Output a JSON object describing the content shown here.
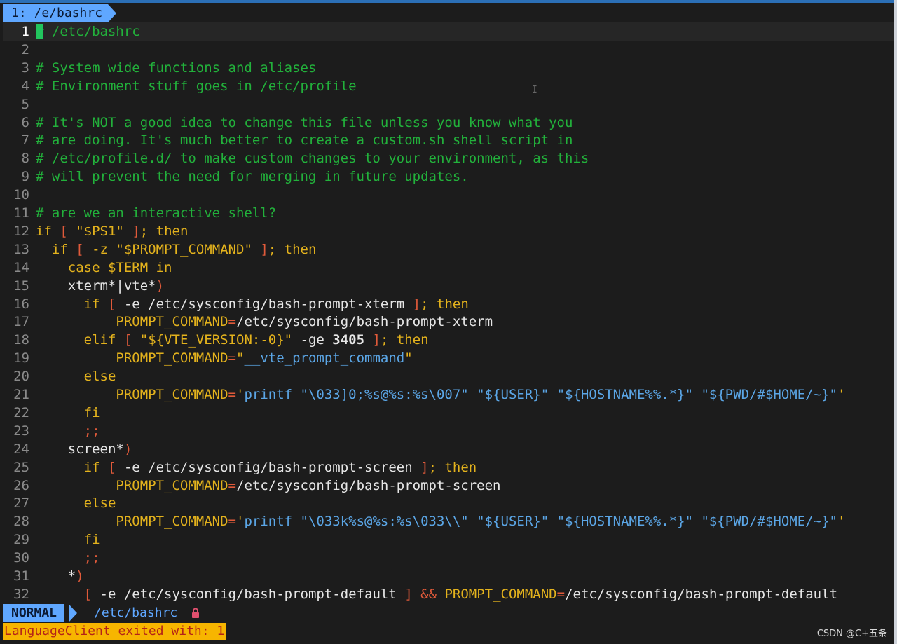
{
  "tab": {
    "label": "1: /e/bashrc"
  },
  "status": {
    "mode": "NORMAL",
    "file": "/etc/bashrc"
  },
  "message": "LanguageClient exited with: 1",
  "watermark": "CSDN @C+五条",
  "colors": {
    "comment": "#22b13b",
    "keyword": "#e3b21d",
    "bracket": "#e05a3a",
    "string": "#5ba6e6",
    "accent": "#5fa7ff"
  },
  "lines": [
    {
      "n": "1",
      "current": true,
      "segs": [
        [
          "cursor",
          "#"
        ],
        [
          "c",
          " /etc/bashrc"
        ]
      ]
    },
    {
      "n": "2",
      "segs": []
    },
    {
      "n": "3",
      "segs": [
        [
          "c",
          "# System wide functions and aliases"
        ]
      ]
    },
    {
      "n": "4",
      "segs": [
        [
          "c",
          "# Environment stuff goes in /etc/profile"
        ]
      ]
    },
    {
      "n": "5",
      "segs": []
    },
    {
      "n": "6",
      "segs": [
        [
          "c",
          "# It's NOT a good idea to change this file unless you know what you"
        ]
      ]
    },
    {
      "n": "7",
      "segs": [
        [
          "c",
          "# are doing. It's much better to create a custom.sh shell script in"
        ]
      ]
    },
    {
      "n": "8",
      "segs": [
        [
          "c",
          "# /etc/profile.d/ to make custom changes to your environment, as this"
        ]
      ]
    },
    {
      "n": "9",
      "segs": [
        [
          "c",
          "# will prevent the need for merging in future updates."
        ]
      ]
    },
    {
      "n": "10",
      "segs": []
    },
    {
      "n": "11",
      "segs": [
        [
          "c",
          "# are we an interactive shell?"
        ]
      ]
    },
    {
      "n": "12",
      "segs": [
        [
          "k",
          "if "
        ],
        [
          "b",
          "["
        ],
        [
          "n",
          " "
        ],
        [
          "k",
          "\"$PS1\""
        ],
        [
          "n",
          " "
        ],
        [
          "b",
          "]"
        ],
        [
          "k",
          "; then"
        ]
      ]
    },
    {
      "n": "13",
      "segs": [
        [
          "n",
          "  "
        ],
        [
          "k",
          "if "
        ],
        [
          "b",
          "["
        ],
        [
          "k",
          " -z \"$PROMPT_COMMAND\" "
        ],
        [
          "b",
          "]"
        ],
        [
          "k",
          "; then"
        ]
      ]
    },
    {
      "n": "14",
      "segs": [
        [
          "n",
          "    "
        ],
        [
          "k",
          "case $TERM in"
        ]
      ]
    },
    {
      "n": "15",
      "segs": [
        [
          "n",
          "    xterm*|vte*"
        ],
        [
          "b",
          ")"
        ]
      ]
    },
    {
      "n": "16",
      "segs": [
        [
          "n",
          "      "
        ],
        [
          "k",
          "if "
        ],
        [
          "b",
          "["
        ],
        [
          "n",
          " -e /etc/sysconfig/bash-prompt-xterm "
        ],
        [
          "b",
          "]"
        ],
        [
          "k",
          "; then"
        ]
      ]
    },
    {
      "n": "17",
      "segs": [
        [
          "n",
          "          "
        ],
        [
          "k",
          "PROMPT_COMMAND"
        ],
        [
          "b",
          "="
        ],
        [
          "n",
          "/etc/sysconfig/bash-prompt-xterm"
        ]
      ]
    },
    {
      "n": "18",
      "segs": [
        [
          "n",
          "      "
        ],
        [
          "k",
          "elif "
        ],
        [
          "b",
          "["
        ],
        [
          "n",
          " "
        ],
        [
          "k",
          "\"${VTE_VERSION:-0}\""
        ],
        [
          "n",
          " -ge "
        ],
        [
          "w",
          "3405"
        ],
        [
          "n",
          " "
        ],
        [
          "b",
          "]"
        ],
        [
          "k",
          "; then"
        ]
      ]
    },
    {
      "n": "19",
      "segs": [
        [
          "n",
          "          "
        ],
        [
          "k",
          "PROMPT_COMMAND"
        ],
        [
          "b",
          "="
        ],
        [
          "k",
          "\""
        ],
        [
          "s",
          "__vte_prompt_command"
        ],
        [
          "k",
          "\""
        ]
      ]
    },
    {
      "n": "20",
      "segs": [
        [
          "n",
          "      "
        ],
        [
          "k",
          "else"
        ]
      ]
    },
    {
      "n": "21",
      "segs": [
        [
          "n",
          "          "
        ],
        [
          "k",
          "PROMPT_COMMAND"
        ],
        [
          "b",
          "="
        ],
        [
          "k",
          "'"
        ],
        [
          "s",
          "printf \"\\033]0;%s@%s:%s\\007\" \"${USER}\" \"${HOSTNAME%%.*}\" \"${PWD/#$HOME/~}\""
        ],
        [
          "k",
          "'"
        ]
      ]
    },
    {
      "n": "22",
      "segs": [
        [
          "n",
          "      "
        ],
        [
          "k",
          "fi"
        ]
      ]
    },
    {
      "n": "23",
      "segs": [
        [
          "n",
          "      "
        ],
        [
          "b",
          ";;"
        ]
      ]
    },
    {
      "n": "24",
      "segs": [
        [
          "n",
          "    screen*"
        ],
        [
          "b",
          ")"
        ]
      ]
    },
    {
      "n": "25",
      "segs": [
        [
          "n",
          "      "
        ],
        [
          "k",
          "if "
        ],
        [
          "b",
          "["
        ],
        [
          "n",
          " -e /etc/sysconfig/bash-prompt-screen "
        ],
        [
          "b",
          "]"
        ],
        [
          "k",
          "; then"
        ]
      ]
    },
    {
      "n": "26",
      "segs": [
        [
          "n",
          "          "
        ],
        [
          "k",
          "PROMPT_COMMAND"
        ],
        [
          "b",
          "="
        ],
        [
          "n",
          "/etc/sysconfig/bash-prompt-screen"
        ]
      ]
    },
    {
      "n": "27",
      "segs": [
        [
          "n",
          "      "
        ],
        [
          "k",
          "else"
        ]
      ]
    },
    {
      "n": "28",
      "segs": [
        [
          "n",
          "          "
        ],
        [
          "k",
          "PROMPT_COMMAND"
        ],
        [
          "b",
          "="
        ],
        [
          "k",
          "'"
        ],
        [
          "s",
          "printf \"\\033k%s@%s:%s\\033\\\\\" \"${USER}\" \"${HOSTNAME%%.*}\" \"${PWD/#$HOME/~}\""
        ],
        [
          "k",
          "'"
        ]
      ]
    },
    {
      "n": "29",
      "segs": [
        [
          "n",
          "      "
        ],
        [
          "k",
          "fi"
        ]
      ]
    },
    {
      "n": "30",
      "segs": [
        [
          "n",
          "      "
        ],
        [
          "b",
          ";;"
        ]
      ]
    },
    {
      "n": "31",
      "segs": [
        [
          "n",
          "    *"
        ],
        [
          "b",
          ")"
        ]
      ]
    },
    {
      "n": "32",
      "segs": [
        [
          "n",
          "      "
        ],
        [
          "b",
          "["
        ],
        [
          "n",
          " -e /etc/sysconfig/bash-prompt-default "
        ],
        [
          "b",
          "]"
        ],
        [
          "n",
          " "
        ],
        [
          "b",
          "&&"
        ],
        [
          "n",
          " "
        ],
        [
          "k",
          "PROMPT_COMMAND"
        ],
        [
          "b",
          "="
        ],
        [
          "n",
          "/etc/sysconfig/bash-prompt-default"
        ]
      ]
    }
  ]
}
